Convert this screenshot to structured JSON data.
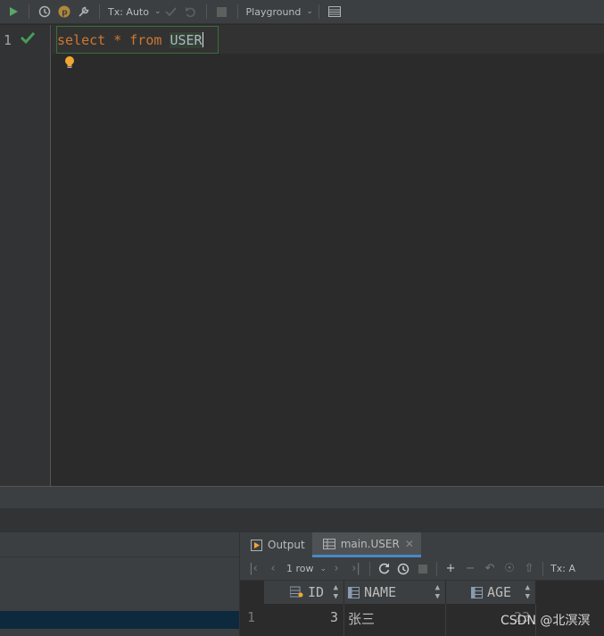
{
  "toolbar": {
    "tx_mode": "Tx: Auto",
    "playground": "Playground"
  },
  "editor": {
    "line_number": "1",
    "keyword_select": "select",
    "star": "*",
    "keyword_from": "from",
    "table_name": "USER"
  },
  "results": {
    "tabs": [
      {
        "label": "Output"
      },
      {
        "label": "main.USER"
      }
    ],
    "row_count": "1 row",
    "tx_mode": "Tx: A",
    "columns": [
      "ID",
      "NAME",
      "AGE"
    ],
    "rows": [
      {
        "row_no": "1",
        "id": "3",
        "name": "张三",
        "age": "23"
      }
    ]
  },
  "watermark": "CSDN @北溟溟",
  "colors": {
    "keyword": "#cc7832",
    "identifier": "#a9b7c6",
    "run": "#59a869",
    "check": "#499c54",
    "bulb": "#f0a732",
    "accent": "#4a88c7"
  }
}
